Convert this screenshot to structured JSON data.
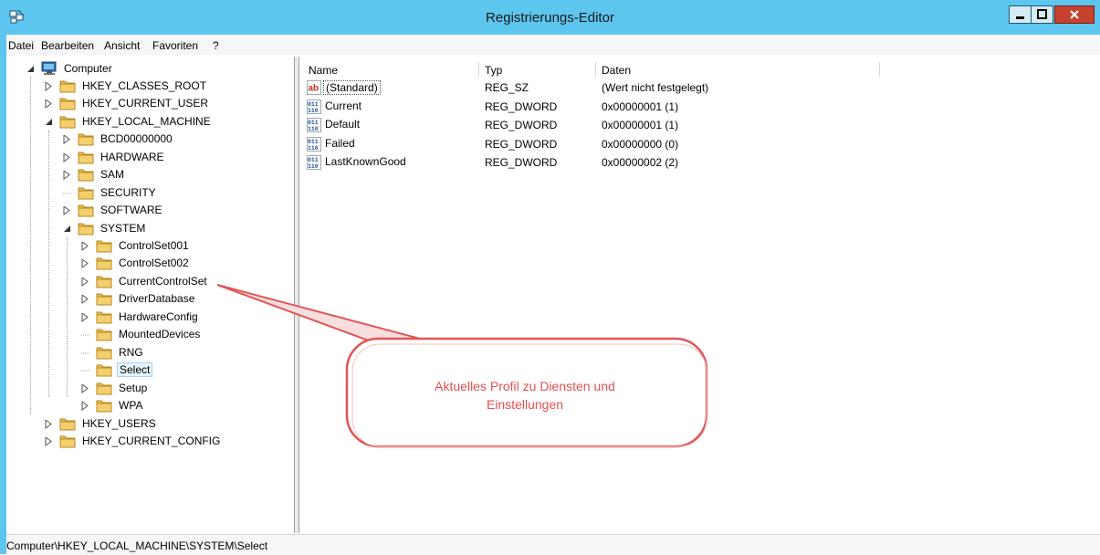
{
  "window": {
    "title": "Registrierungs-Editor",
    "buttons": {
      "minimize": "_",
      "maximize": "□",
      "close": "x"
    },
    "accent": "#5cc6ef"
  },
  "menu": [
    "Datei",
    "Bearbeiten",
    "Ansicht",
    "Favoriten",
    "?"
  ],
  "tree": [
    {
      "label": "Computer",
      "state": "expanded",
      "icon": "computer-icon"
    },
    {
      "label": "HKEY_CLASSES_ROOT",
      "state": "collapsed",
      "icon": "folder-icon"
    },
    {
      "label": "HKEY_CURRENT_USER",
      "state": "collapsed",
      "icon": "folder-icon"
    },
    {
      "label": "HKEY_LOCAL_MACHINE",
      "state": "expanded",
      "icon": "folder-icon"
    },
    {
      "label": "BCD00000000",
      "state": "collapsed",
      "icon": "folder-icon"
    },
    {
      "label": "HARDWARE",
      "state": "collapsed",
      "icon": "folder-icon"
    },
    {
      "label": "SAM",
      "state": "collapsed",
      "icon": "folder-icon"
    },
    {
      "label": "SECURITY",
      "state": "leaf",
      "icon": "folder-icon"
    },
    {
      "label": "SOFTWARE",
      "state": "collapsed",
      "icon": "folder-icon"
    },
    {
      "label": "SYSTEM",
      "state": "expanded",
      "icon": "folder-icon"
    },
    {
      "label": "ControlSet001",
      "state": "collapsed",
      "icon": "folder-icon"
    },
    {
      "label": "ControlSet002",
      "state": "collapsed",
      "icon": "folder-icon"
    },
    {
      "label": "CurrentControlSet",
      "state": "collapsed",
      "icon": "folder-icon"
    },
    {
      "label": "DriverDatabase",
      "state": "collapsed",
      "icon": "folder-icon"
    },
    {
      "label": "HardwareConfig",
      "state": "collapsed",
      "icon": "folder-icon"
    },
    {
      "label": "MountedDevices",
      "state": "leaf",
      "icon": "folder-icon"
    },
    {
      "label": "RNG",
      "state": "leaf",
      "icon": "folder-icon"
    },
    {
      "label": "Select",
      "state": "leaf",
      "icon": "folder-icon",
      "selected": true
    },
    {
      "label": "Setup",
      "state": "collapsed",
      "icon": "folder-icon"
    },
    {
      "label": "WPA",
      "state": "collapsed",
      "icon": "folder-icon"
    },
    {
      "label": "HKEY_USERS",
      "state": "collapsed",
      "icon": "folder-icon"
    },
    {
      "label": "HKEY_CURRENT_CONFIG",
      "state": "collapsed",
      "icon": "folder-icon"
    }
  ],
  "list": {
    "columns": [
      "Name",
      "Typ",
      "Daten"
    ],
    "rows": [
      {
        "name": "(Standard)",
        "type": "REG_SZ",
        "data": "(Wert nicht festgelegt)",
        "icon": "string-value-icon"
      },
      {
        "name": "Current",
        "type": "REG_DWORD",
        "data": "0x00000001 (1)",
        "icon": "binary-value-icon"
      },
      {
        "name": "Default",
        "type": "REG_DWORD",
        "data": "0x00000001 (1)",
        "icon": "binary-value-icon"
      },
      {
        "name": "Failed",
        "type": "REG_DWORD",
        "data": "0x00000000 (0)",
        "icon": "binary-value-icon"
      },
      {
        "name": "LastKnownGood",
        "type": "REG_DWORD",
        "data": "0x00000002 (2)",
        "icon": "binary-value-icon"
      }
    ]
  },
  "callout": {
    "line1": "Aktuelles Profil zu Diensten und",
    "line2": "Einstellungen",
    "color": "#e15050"
  },
  "status": "Computer\\HKEY_LOCAL_MACHINE\\SYSTEM\\Select"
}
